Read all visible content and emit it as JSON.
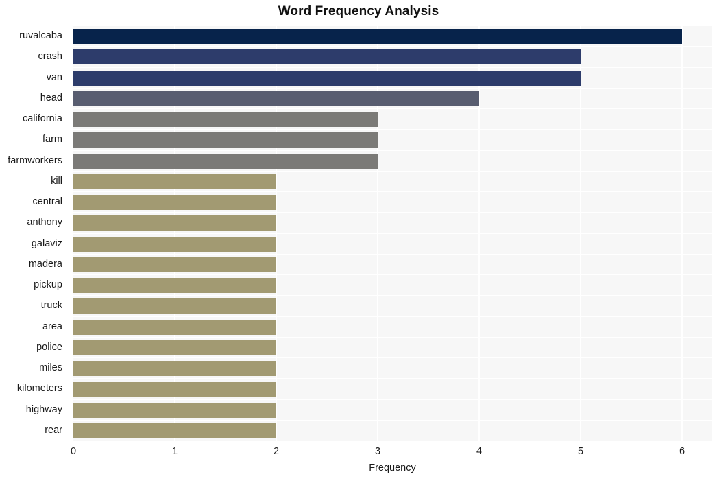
{
  "chart_data": {
    "type": "bar",
    "orientation": "horizontal",
    "title": "Word Frequency Analysis",
    "xlabel": "Frequency",
    "ylabel": "",
    "xlim": [
      0,
      6
    ],
    "xticks": [
      0,
      1,
      2,
      3,
      4,
      5,
      6
    ],
    "xtick_labels": [
      "0",
      "1",
      "2",
      "3",
      "4",
      "5",
      "6"
    ],
    "grid": "vertical-white-on-light-gray",
    "legend": "none",
    "categories": [
      "ruvalcaba",
      "crash",
      "van",
      "head",
      "california",
      "farm",
      "farmworkers",
      "kill",
      "central",
      "anthony",
      "galaviz",
      "madera",
      "pickup",
      "truck",
      "area",
      "police",
      "miles",
      "kilometers",
      "highway",
      "rear"
    ],
    "values": [
      6,
      5,
      5,
      4,
      3,
      3,
      3,
      2,
      2,
      2,
      2,
      2,
      2,
      2,
      2,
      2,
      2,
      2,
      2,
      2
    ],
    "bar_colors": [
      "#07234b",
      "#2d3c6b",
      "#2d3c6b",
      "#585d70",
      "#7b7a77",
      "#7b7a77",
      "#7b7a77",
      "#a29a72",
      "#a29a72",
      "#a29a72",
      "#a29a72",
      "#a29a72",
      "#a29a72",
      "#a29a72",
      "#a29a72",
      "#a29a72",
      "#a29a72",
      "#a29a72",
      "#a29a72",
      "#a29a72"
    ]
  },
  "style": {
    "plot_background": "#f7f7f7",
    "gridline_color": "#ffffff",
    "page_background": "#ffffff",
    "text_color": "#1a1a1a",
    "title_color": "#111111"
  }
}
